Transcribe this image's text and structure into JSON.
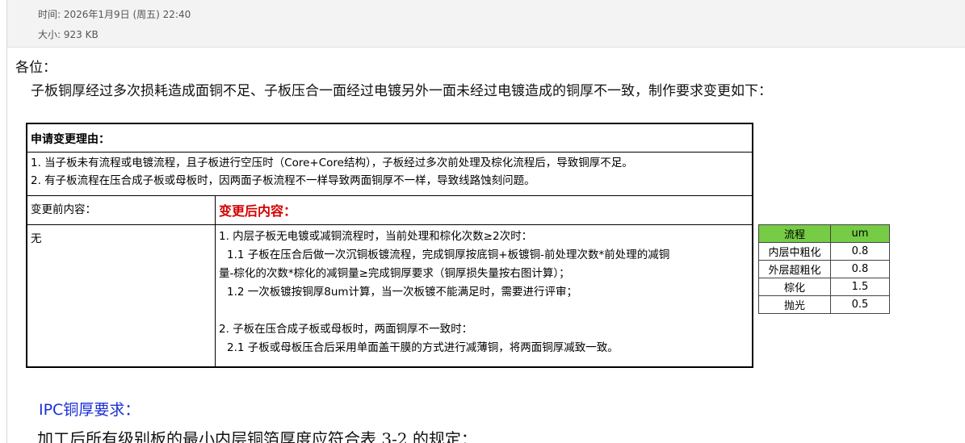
{
  "meta": {
    "time": "时间: 2026年1月9日 (周五) 22:40",
    "size": "大小: 923 KB"
  },
  "body": {
    "greeting": "各位：",
    "intro": "子板铜厚经过多次损耗造成面铜不足、子板压合一面经过电镀另外一面未经过电镀造成的铜厚不一致，制作要求变更如下："
  },
  "change_table": {
    "reason_title": "申请变更理由：",
    "reasons": [
      "1. 当子板未有流程或电镀流程，且子板进行空压时（Core+Core结构），子板经过多次前处理及棕化流程后，导致铜厚不足。",
      "2. 有子板流程在压合成子板或母板时，因两面子板流程不一样导致两面铜厚不一样，导致线路蚀刻问题。"
    ],
    "before_label": "变更前内容：",
    "after_label": "变更后内容：",
    "before_value": "无",
    "after_lines": {
      "l1": "1. 内层子板无电镀或减铜流程时，当前处理和棕化次数≥2次时：",
      "l2": "1.1 子板在压合后做一次沉铜板镀流程，完成铜厚按底铜+板镀铜-前处理次数*前处理的减铜",
      "l3": "量-棕化的次数*棕化的减铜量≥完成铜厚要求（铜厚损失量按右图计算）；",
      "l4": "1.2 一次板镀按铜厚8um计算，当一次板镀不能满足时，需要进行评审；",
      "l5": "2. 子板在压合成子板或母板时，两面铜厚不一致时：",
      "l6": "2.1 子板或母板压合后采用单面盖干膜的方式进行减薄铜，将两面铜厚减致一致。"
    }
  },
  "loss_table": {
    "headers": [
      "流程",
      "um"
    ],
    "rows": [
      [
        "内层中粗化",
        "0.8"
      ],
      [
        "外层超粗化",
        "0.8"
      ],
      [
        "棕化",
        "1.5"
      ],
      [
        "抛光",
        "0.5"
      ]
    ],
    "header_color": "#76cc45"
  },
  "ipc": {
    "title": "IPC铜厚要求：",
    "text": "加工后所有级别板的最小内层铜箔厚度应符合表 3-2 的规定："
  }
}
